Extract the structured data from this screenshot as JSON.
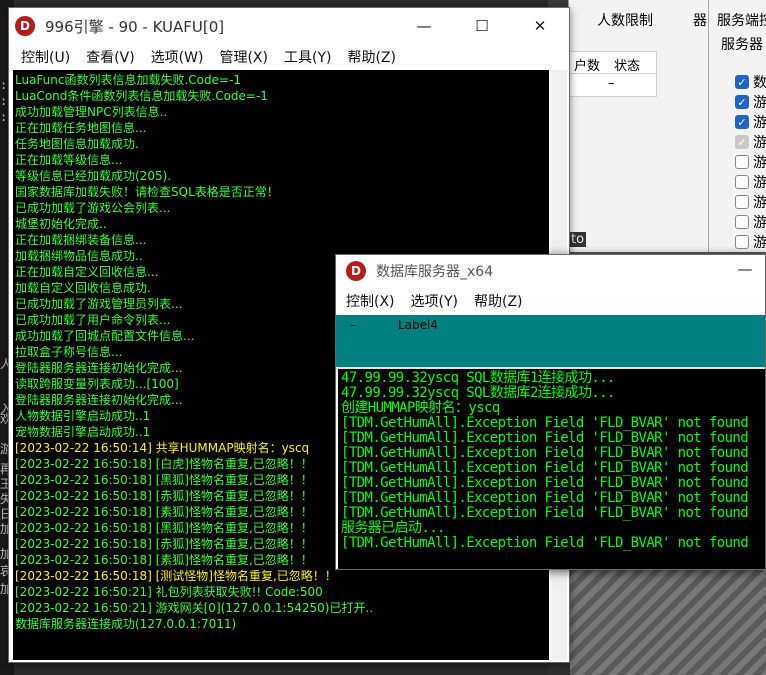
{
  "background": {
    "left_fragments": [
      ":2",
      ":2",
      ":2",
      "人",
      "入",
      "欢",
      "游",
      "再",
      "王",
      "失",
      "日",
      "加",
      "加",
      "哀",
      "加"
    ],
    "player_limit_window": {
      "title_fragment": "人数限制",
      "title_fragment2": "器",
      "columns": [
        "户数",
        "状态"
      ],
      "row_value": "–",
      "bottom_text": "to"
    },
    "server_window": {
      "title": "服务端控",
      "subtitle": "服务器",
      "checkboxes": [
        {
          "label": "数",
          "state": "checked"
        },
        {
          "label": "游",
          "state": "checked"
        },
        {
          "label": "游",
          "state": "checked"
        },
        {
          "label": "游",
          "state": "disabled"
        },
        {
          "label": "游",
          "state": "unchecked"
        },
        {
          "label": "游",
          "state": "unchecked"
        },
        {
          "label": "游",
          "state": "unchecked"
        },
        {
          "label": "游",
          "state": "unchecked"
        },
        {
          "label": "游",
          "state": "unchecked"
        }
      ]
    }
  },
  "main_window": {
    "icon_letter": "D",
    "title": "996引擎 - 90 - KUAFU[0]",
    "controls": {
      "minimize": "—",
      "maximize": "☐",
      "close": "✕"
    },
    "menu": [
      "控制(U)",
      "查看(V)",
      "选项(W)",
      "管理(X)",
      "工具(Y)",
      "帮助(Z)"
    ],
    "log": [
      {
        "text": "LuaFunc函数列表信息加载失败.Code=-1",
        "color": "green"
      },
      {
        "text": "LuaCond条件函数列表信息加载失败.Code=-1",
        "color": "green"
      },
      {
        "text": "成功加载管理NPC列表信息..",
        "color": "green"
      },
      {
        "text": "正在加载任务地图信息...",
        "color": "green"
      },
      {
        "text": "任务地图信息加载成功.",
        "color": "green"
      },
      {
        "text": "正在加载等级信息...",
        "color": "green"
      },
      {
        "text": "等级信息已经加载成功(205).",
        "color": "green"
      },
      {
        "text": "国家数据库加载失败！请检查SQL表格是否正常！",
        "color": "green"
      },
      {
        "text": "已成功加载了游戏公会列表...",
        "color": "green"
      },
      {
        "text": "城堡初始化完成..",
        "color": "green"
      },
      {
        "text": "正在加载捆绑装备信息...",
        "color": "green"
      },
      {
        "text": "加载捆绑物品信息成功..",
        "color": "green"
      },
      {
        "text": "正在加载自定义回收信息...",
        "color": "green"
      },
      {
        "text": "加载自定义回收信息成功.",
        "color": "green"
      },
      {
        "text": "已成功加载了游戏管理员列表...",
        "color": "green"
      },
      {
        "text": "已成功加载了用户命令列表...",
        "color": "green"
      },
      {
        "text": "成功加载了回城点配置文件信息...",
        "color": "green"
      },
      {
        "text": "拉取盒子称号信息...",
        "color": "green"
      },
      {
        "text": "登陆器服务器连接初始化完成...",
        "color": "green"
      },
      {
        "text": "读取跨服变量列表成功...[100]",
        "color": "green"
      },
      {
        "text": "登陆器服务器连接初始化完成...",
        "color": "green"
      },
      {
        "text": "人物数据引擎启动成功..1",
        "color": "green"
      },
      {
        "text": "宠物数据引擎启动成功..1",
        "color": "green"
      },
      {
        "text": "[2023-02-22 16:50:14] 共享HUMMAP映射名：yscq",
        "color": "yellow"
      },
      {
        "text": "[2023-02-22 16:50:18] [白虎]怪物名重复,已忽略！！",
        "color": "green"
      },
      {
        "text": "[2023-02-22 16:50:18] [黑狐]怪物名重复,已忽略！！",
        "color": "green"
      },
      {
        "text": "[2023-02-22 16:50:18] [赤狐]怪物名重复,已忽略！！",
        "color": "green"
      },
      {
        "text": "[2023-02-22 16:50:18] [素狐]怪物名重复,已忽略！！",
        "color": "green"
      },
      {
        "text": "[2023-02-22 16:50:18] [黑狐]怪物名重复,已忽略！！",
        "color": "green"
      },
      {
        "text": "[2023-02-22 16:50:18] [赤狐]怪物名重复,已忽略！！",
        "color": "green"
      },
      {
        "text": "[2023-02-22 16:50:18] [素狐]怪物名重复,已忽略！！",
        "color": "green"
      },
      {
        "text": "[2023-02-22 16:50:18] [测试怪物]怪物名重复,已忽略！！",
        "color": "yellow"
      },
      {
        "text": "[2023-02-22 16:50:21] 礼包列表获取失败!! Code:500",
        "color": "green"
      },
      {
        "text": "[2023-02-22 16:50:21] 游戏网关[0](127.0.0.1:54250)已打开..",
        "color": "green"
      },
      {
        "text": "数据库服务器连接成功(127.0.0.1:7011)",
        "color": "green"
      }
    ]
  },
  "db_window": {
    "icon_letter": "D",
    "title": "数据库服务器_x64",
    "controls": {
      "minimize": "—"
    },
    "menu": [
      "控制(X)",
      "选项(Y)",
      "帮助(Z)"
    ],
    "panel_dash": "–",
    "panel_label": "Label4",
    "log": [
      "47.99.99.32yscq SQL数据库1连接成功...",
      "47.99.99.32yscq SQL数据库2连接成功...",
      "创建HUMMAP映射名：yscq",
      "[TDM.GetHumAll].Exception Field 'FLD_BVAR' not found",
      "[TDM.GetHumAll].Exception Field 'FLD_BVAR' not found",
      "[TDM.GetHumAll].Exception Field 'FLD_BVAR' not found",
      "[TDM.GetHumAll].Exception Field 'FLD_BVAR' not found",
      "[TDM.GetHumAll].Exception Field 'FLD_BVAR' not found",
      "[TDM.GetHumAll].Exception Field 'FLD_BVAR' not found",
      "[TDM.GetHumAll].Exception Field 'FLD_BVAR' not found",
      "服务器已启动...",
      "[TDM.GetHumAll].Exception Field 'FLD_BVAR' not found"
    ]
  },
  "colors": {
    "console_green": "#38ff38",
    "console_yellow": "#fdf300",
    "db_green": "#00ff00",
    "teal": "#008080",
    "icon_red": "#b51c1c"
  }
}
